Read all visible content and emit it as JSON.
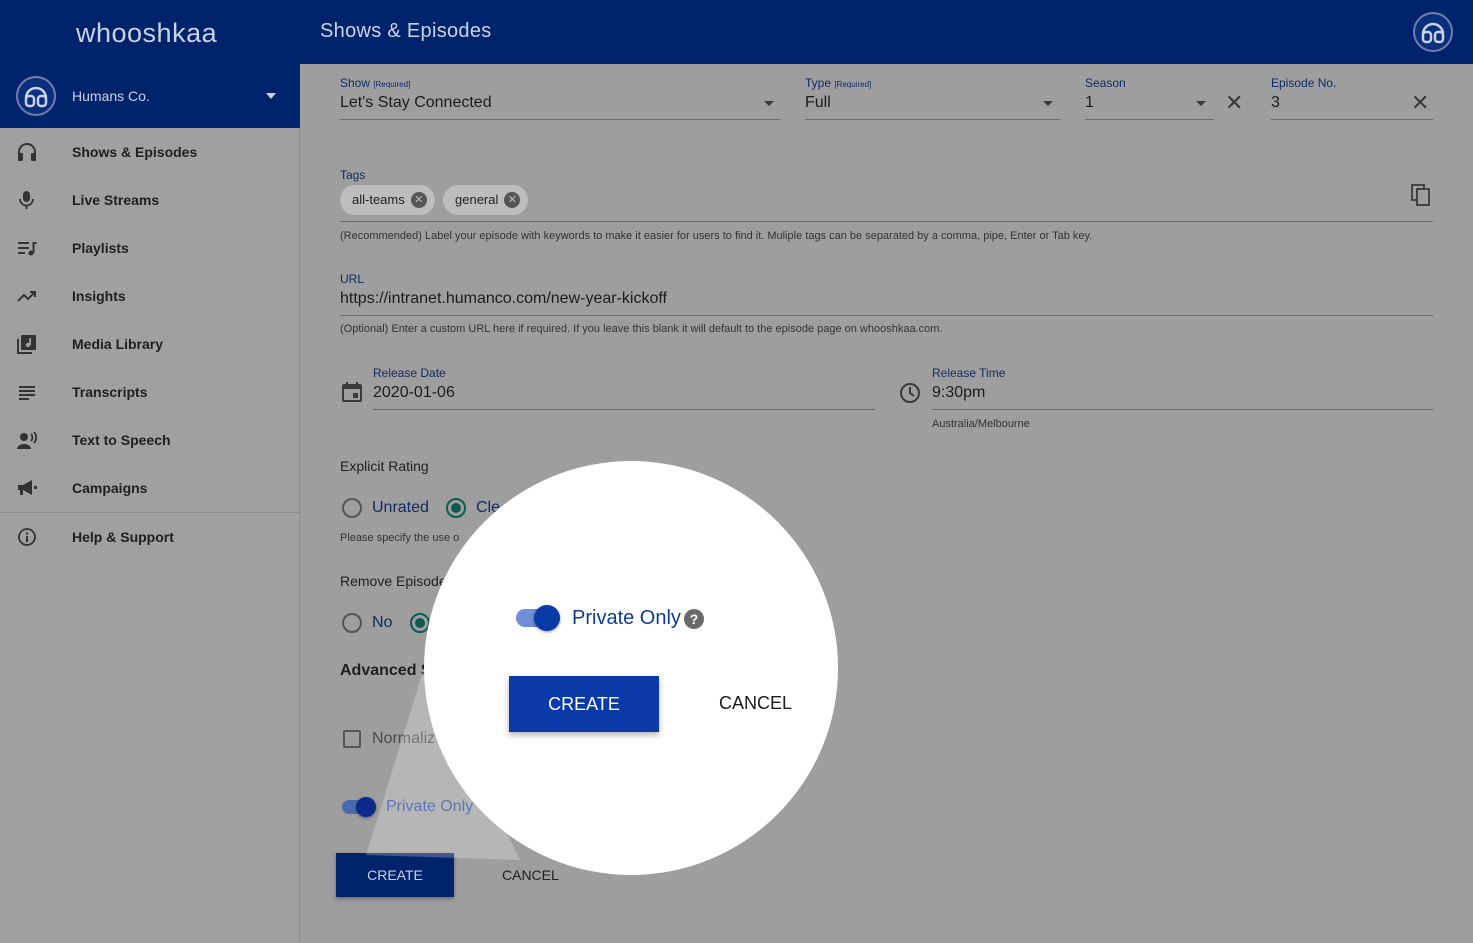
{
  "app": {
    "logo": "whooshkaa",
    "page_title": "Shows & Episodes"
  },
  "sidebar": {
    "org_name": "Humans Co.",
    "items": [
      {
        "label": "Shows & Episodes",
        "icon": "headphones-icon"
      },
      {
        "label": "Live Streams",
        "icon": "microphone-icon"
      },
      {
        "label": "Playlists",
        "icon": "playlist-icon"
      },
      {
        "label": "Insights",
        "icon": "trending-up-icon"
      },
      {
        "label": "Media Library",
        "icon": "library-music-icon"
      },
      {
        "label": "Transcripts",
        "icon": "notes-icon"
      },
      {
        "label": "Text to Speech",
        "icon": "speaker-person-icon"
      },
      {
        "label": "Campaigns",
        "icon": "megaphone-icon"
      },
      {
        "label": "Help & Support",
        "icon": "info-icon"
      }
    ]
  },
  "form": {
    "show": {
      "label": "Show",
      "required": "[Required]",
      "value": "Let's Stay Connected"
    },
    "type": {
      "label": "Type",
      "required": "[Required]",
      "value": "Full"
    },
    "season": {
      "label": "Season",
      "value": "1"
    },
    "episode_no": {
      "label": "Episode No.",
      "value": "3"
    },
    "tags": {
      "label": "Tags",
      "chips": [
        "all-teams",
        "general"
      ],
      "helper": "(Recommended) Label your episode with keywords to make it easier for users to find it. Muliple tags can be separated by a comma, pipe, Enter or Tab key."
    },
    "url": {
      "label": "URL",
      "value": "https://intranet.humanco.com/new-year-kickoff",
      "helper": "(Optional) Enter a custom URL here if required. If you leave this blank it will default to the episode page on whooshkaa.com."
    },
    "release_date": {
      "label": "Release Date",
      "value": "2020-01-06"
    },
    "release_time": {
      "label": "Release Time",
      "value": "9:30pm",
      "timezone": "Australia/Melbourne"
    },
    "explicit": {
      "label": "Explicit Rating",
      "options": [
        "Unrated",
        "Cle"
      ],
      "helper": "Please specify the use o"
    },
    "remove_episode": {
      "label": "Remove Episode",
      "options": [
        "No"
      ]
    },
    "advanced": {
      "label": "Advanced S"
    },
    "normalize": {
      "label": "Normaliz"
    },
    "private_only": {
      "label": "Private Only"
    },
    "create_label": "CREATE",
    "cancel_label": "CANCEL"
  },
  "magnifier": {
    "private_label": "Private Only",
    "help_glyph": "?",
    "create_label": "CREATE",
    "cancel_label": "CANCEL"
  }
}
